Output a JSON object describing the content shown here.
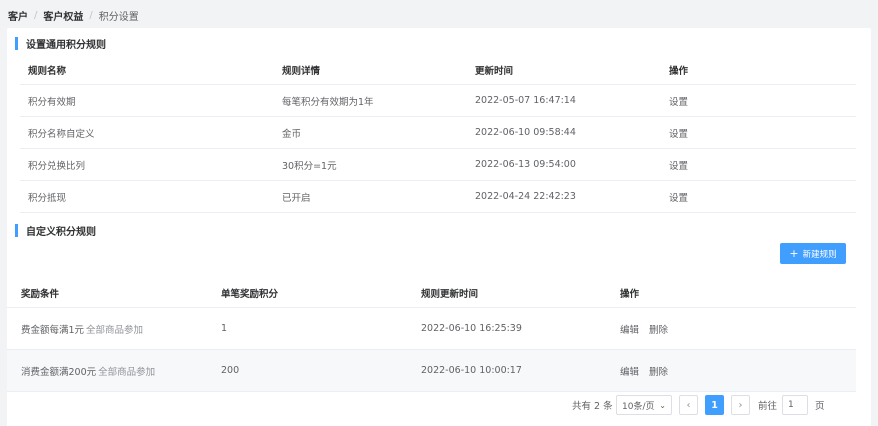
{
  "breadcrumb": {
    "level1": "客户",
    "level2": "客户权益",
    "current": "积分设置",
    "separator": "/"
  },
  "general_rules": {
    "title": "设置通用积分规则",
    "columns": {
      "name": "规则名称",
      "detail": "规则详情",
      "updated": "更新时间",
      "action": "操作"
    },
    "rows": [
      {
        "name": "积分有效期",
        "detail": "每笔积分有效期为1年",
        "updated": "2022-05-07 16:47:14",
        "action": "设置"
      },
      {
        "name": "积分名称自定义",
        "detail": "金币",
        "updated": "2022-06-10 09:58:44",
        "action": "设置"
      },
      {
        "name": "积分兑换比列",
        "detail": "30积分=1元",
        "updated": "2022-06-13 09:54:00",
        "action": "设置"
      },
      {
        "name": "积分抵现",
        "detail": "已开启",
        "updated": "2022-04-24 22:42:23",
        "action": "设置"
      }
    ]
  },
  "custom_rules": {
    "title": "自定义积分规则",
    "new_button": "新建规则",
    "new_button_icon": "plus-icon",
    "columns": {
      "condition": "奖励条件",
      "points": "单笔奖励积分",
      "updated": "规则更新时间",
      "action": "操作"
    },
    "rows": [
      {
        "condition": "费金额每满1元",
        "scope": "全部商品参加",
        "points": "1",
        "updated": "2022-06-10 16:25:39",
        "edit": "编辑",
        "delete": "删除"
      },
      {
        "condition": "消费金额满200元",
        "scope": "全部商品参加",
        "points": "200",
        "updated": "2022-06-10 10:00:17",
        "edit": "编辑",
        "delete": "删除"
      }
    ]
  },
  "pagination": {
    "total_text": "共有 2 条",
    "page_size": "10条/页",
    "prev_icon": "chevron-left-icon",
    "next_icon": "chevron-right-icon",
    "current_page": "1",
    "goto_label": "前往",
    "goto_value": "1",
    "goto_suffix": "页"
  },
  "colors": {
    "accent": "#409eff",
    "border": "#ebeef5",
    "background": "#f2f3f5"
  }
}
